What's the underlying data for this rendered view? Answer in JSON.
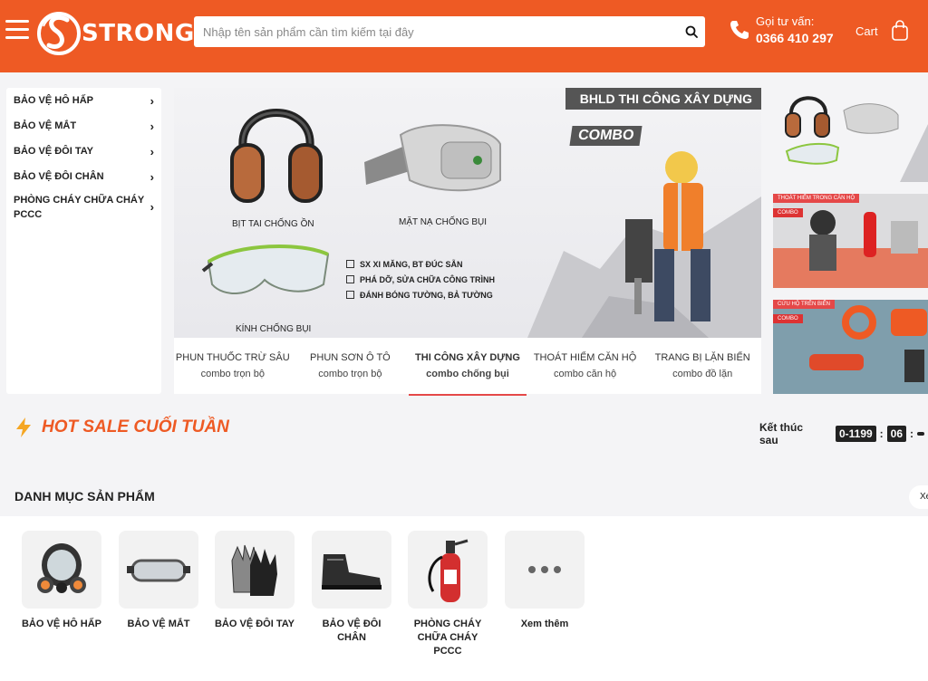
{
  "header": {
    "logo_text": "STRONG",
    "search_placeholder": "Nhập tên sản phẩm cần tìm kiếm tại đây",
    "phone_label": "Gọi tư vấn:",
    "phone_number": "0366 410 297",
    "cart_label": "Cart",
    "brand_color": "#ee5a24"
  },
  "sidebar": {
    "items": [
      {
        "label": "BẢO VỆ HÔ HẤP"
      },
      {
        "label": "BẢO VỆ MẮT"
      },
      {
        "label": "BẢO VỆ ĐÔI TAY"
      },
      {
        "label": "BẢO VỆ ĐÔI CHÂN"
      },
      {
        "label": "PHÒNG CHÁY CHỮA CHÁY PCCC"
      }
    ]
  },
  "banner": {
    "title": "BHLD THI CÔNG XÂY DỰNG",
    "combo": "COMBO",
    "labels": {
      "earmuff": "BỊT TAI CHỐNG ỒN",
      "mask": "MẶT NẠ CHỐNG BỤI",
      "glasses": "KÍNH CHỐNG BỤI"
    },
    "checklist": [
      "SX XI MĂNG, BT ĐÚC SẴN",
      "PHÁ DỠ, SỬA CHỮA CÔNG TRÌNH",
      "ĐÁNH BÓNG TƯỜNG, BẢ TƯỜNG"
    ]
  },
  "tabs": [
    {
      "title": "PHUN THUỐC TRỪ SÂU",
      "sub": "combo trọn bộ"
    },
    {
      "title": "PHUN SƠN Ô TÔ",
      "sub": "combo trọn bộ"
    },
    {
      "title": "THI CÔNG XÂY DỰNG",
      "sub": "combo chống bụi"
    },
    {
      "title": "THOÁT HIỂM CĂN HỘ",
      "sub": "combo căn hộ"
    },
    {
      "title": "TRANG BỊ LẶN BIỂN",
      "sub": "combo đồ lặn"
    }
  ],
  "promos": {
    "promo2_title": "THOÁT HIỂM TRONG CĂN HỘ",
    "promo3_title": "CỨU HỘ TRÊN BIỂN",
    "combo": "COMBO"
  },
  "hotsale": {
    "title": "HOT SALE CUỐI TUẦN",
    "ends_label": "Kết thúc sau",
    "hours": "0-1199",
    "minutes": "06"
  },
  "categories": {
    "title": "DANH MỤC SẢN PHẨM",
    "more_button": "Xe",
    "items": [
      {
        "label": "BẢO VỆ HÔ HẤP"
      },
      {
        "label": "BẢO VỆ MẮT"
      },
      {
        "label": "BẢO VỆ ĐÔI TAY"
      },
      {
        "label": "BẢO VỆ ĐÔI CHÂN"
      },
      {
        "label": "PHÒNG CHÁY CHỮA CHÁY PCCC"
      },
      {
        "label": "Xem thêm"
      }
    ]
  }
}
